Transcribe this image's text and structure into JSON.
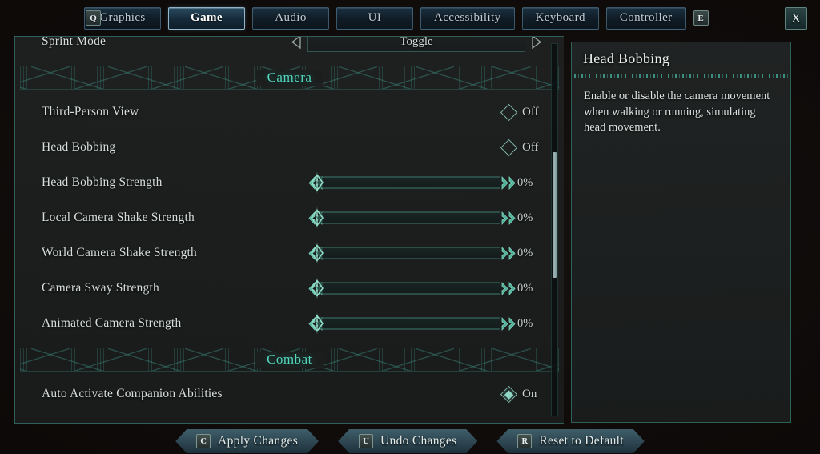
{
  "theme": {
    "accent_teal": "#55d6bd",
    "border_teal": "#2f6058",
    "text_light": "#d7dedc",
    "background": "#100b0a"
  },
  "tabbar": {
    "prev_key": "Q",
    "next_key": "E",
    "close_label": "X",
    "tabs": [
      {
        "label": "Graphics",
        "active": false
      },
      {
        "label": "Game",
        "active": true
      },
      {
        "label": "Audio",
        "active": false
      },
      {
        "label": "UI",
        "active": false
      },
      {
        "label": "Accessibility",
        "active": false
      },
      {
        "label": "Keyboard",
        "active": false
      },
      {
        "label": "Controller",
        "active": false
      }
    ]
  },
  "settings": {
    "rows": [
      {
        "type": "selector",
        "label": "Sprint Mode",
        "value": "Toggle",
        "left_arrow": "left-triangle-icon",
        "right_arrow": "right-triangle-icon"
      },
      {
        "type": "section",
        "label": "Camera"
      },
      {
        "type": "checkbox",
        "label": "Third-Person View",
        "value": "Off",
        "checked": false
      },
      {
        "type": "checkbox",
        "label": "Head Bobbing",
        "value": "Off",
        "checked": false
      },
      {
        "type": "slider",
        "label": "Head Bobbing Strength",
        "value": "0%",
        "percent": 0
      },
      {
        "type": "slider",
        "label": "Local Camera Shake Strength",
        "value": "0%",
        "percent": 0
      },
      {
        "type": "slider",
        "label": "World Camera Shake Strength",
        "value": "0%",
        "percent": 0
      },
      {
        "type": "slider",
        "label": "Camera Sway Strength",
        "value": "0%",
        "percent": 0
      },
      {
        "type": "slider",
        "label": "Animated Camera Strength",
        "value": "0%",
        "percent": 0
      },
      {
        "type": "section",
        "label": "Combat"
      },
      {
        "type": "checkbox",
        "label": "Auto Activate Companion Abilities",
        "value": "On",
        "checked": true
      }
    ],
    "scrollbar": {
      "thumb_top_pct": 29,
      "thumb_height_pct": 34
    }
  },
  "info": {
    "title": "Head Bobbing",
    "description": "Enable or disable the camera movement when walking or running, simulating head movement."
  },
  "actions": [
    {
      "key": "C",
      "label": "Apply Changes"
    },
    {
      "key": "U",
      "label": "Undo Changes"
    },
    {
      "key": "R",
      "label": "Reset to Default"
    }
  ]
}
